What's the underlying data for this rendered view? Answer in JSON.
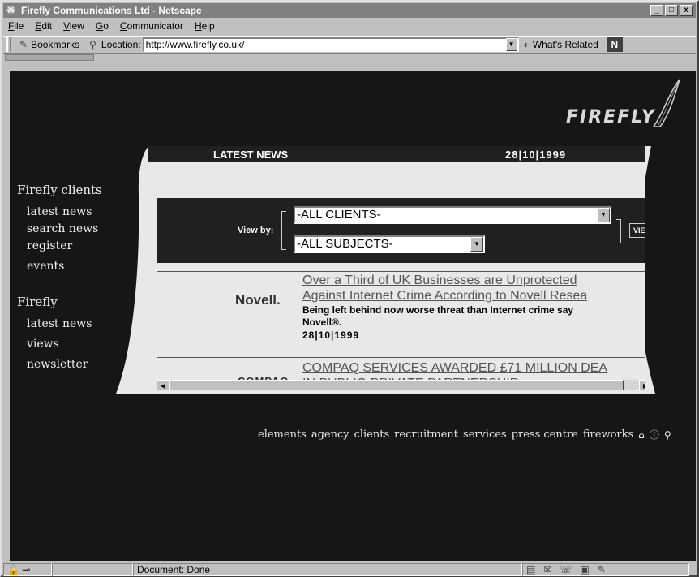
{
  "window": {
    "title": "Firefly Communications Ltd - Netscape",
    "controls": [
      "_",
      "□",
      "x"
    ]
  },
  "menu": [
    "File",
    "Edit",
    "View",
    "Go",
    "Communicator",
    "Help"
  ],
  "toolbar": {
    "bookmarks_label": "Bookmarks",
    "location_label": "Location:",
    "url": "http://www.firefly.co.uk/",
    "whats_related_label": "What's Related",
    "n_logo": "N"
  },
  "brand": "FIREFLY",
  "sidebar": {
    "group1_title": "Firefly clients",
    "group1_items": [
      "latest news",
      "search news",
      "register",
      "events"
    ],
    "group2_title": "Firefly",
    "group2_items": [
      "latest news",
      "views",
      "newsletter"
    ]
  },
  "news": {
    "header_title": "LATEST NEWS",
    "header_date": "28|10|1999",
    "view_by_label": "View by:",
    "clients_select": "-ALL CLIENTS-",
    "subjects_select": "-ALL SUBJECTS-",
    "view_button": "VIE",
    "items": [
      {
        "logo": "Novell.",
        "headline_1": "Over a Third of UK Businesses are Unprotected",
        "headline_2": "Against Internet Crime According to Novell Resea",
        "summary_1": "Being left behind now worse threat than Internet crime say",
        "summary_2": "Novell®.",
        "date": "28|10|1999"
      },
      {
        "logo": "COMPAQ",
        "headline_1": "COMPAQ SERVICES AWARDED £71 MILLION DEA",
        "headline_2": "IN PUBLIC-PRIVATE PARTNERSHIP"
      }
    ]
  },
  "bottom_nav": [
    "elements",
    "agency",
    "clients",
    "recruitment",
    "services",
    "press centre",
    "fireworks"
  ],
  "bottom_icons": [
    "home-icon",
    "info-icon",
    "search-icon"
  ],
  "status": {
    "text": "Document: Done"
  }
}
